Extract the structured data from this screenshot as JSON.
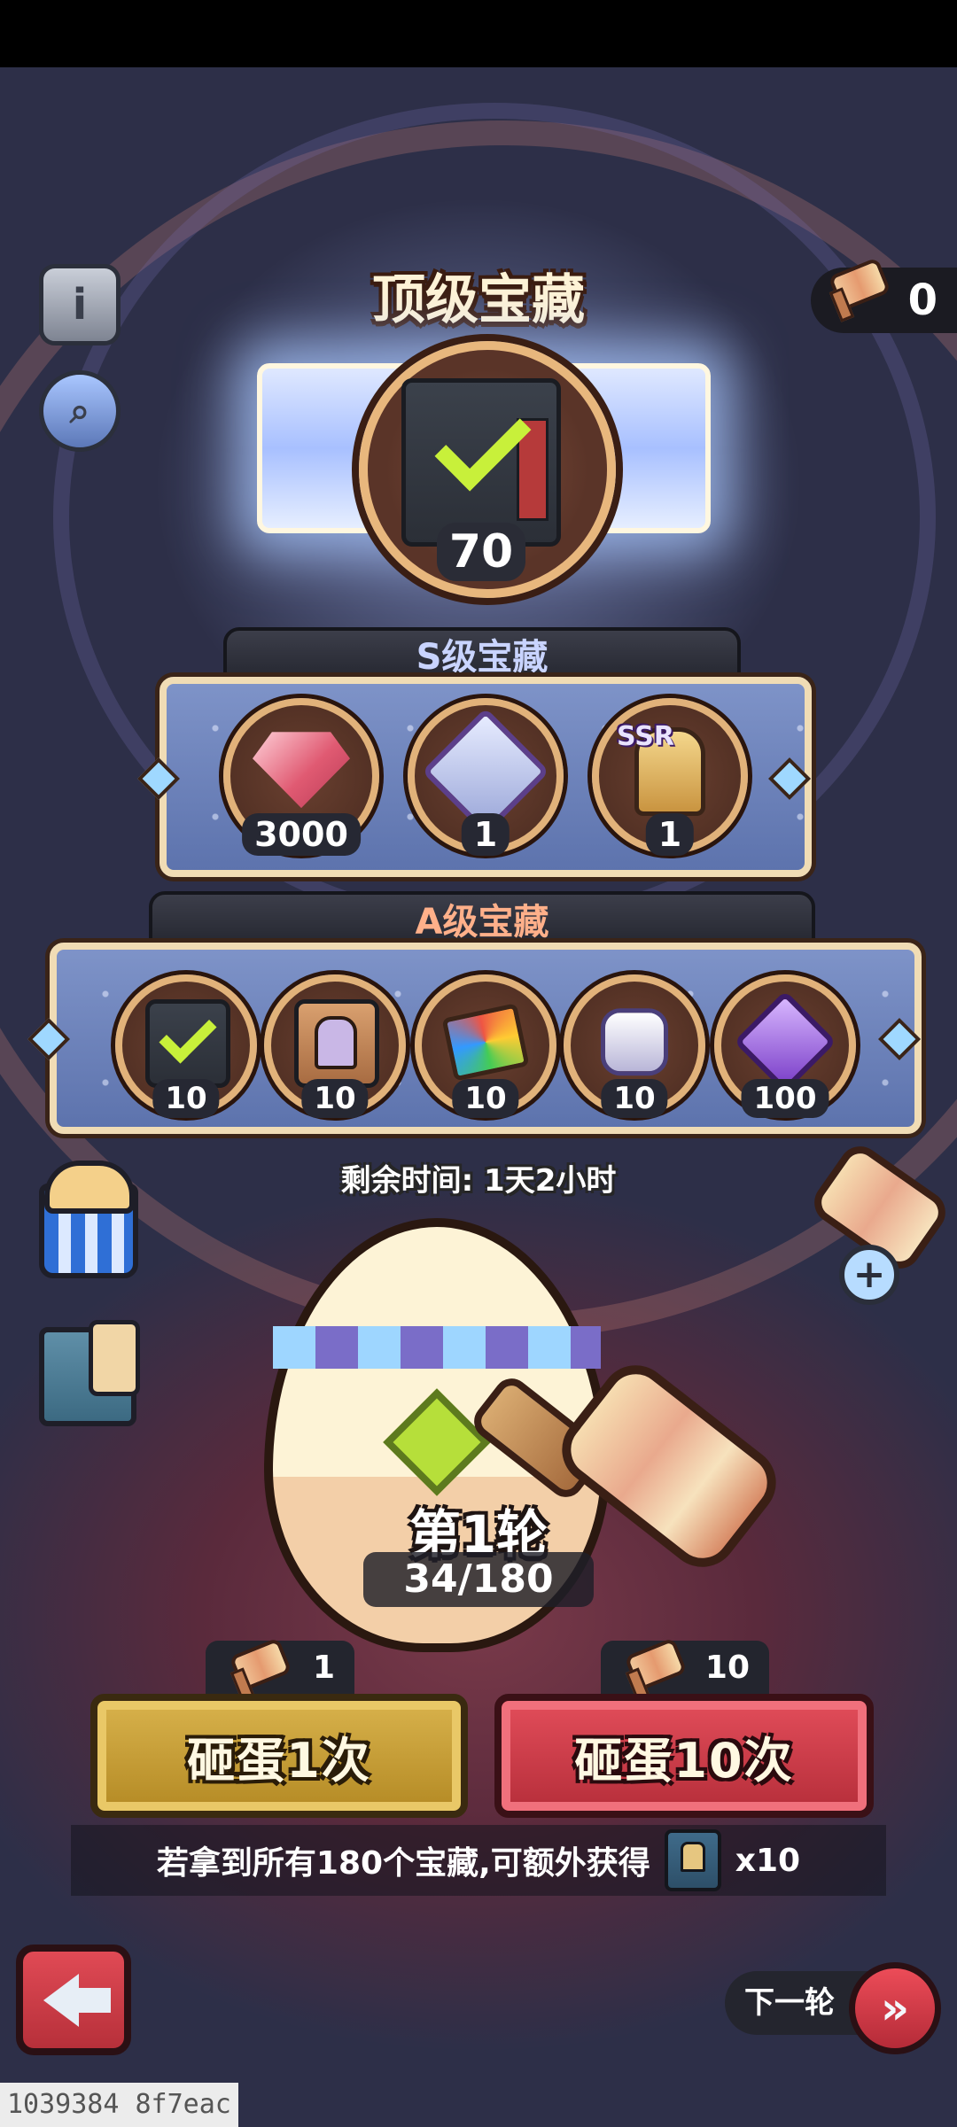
{
  "header": {
    "title": "顶级宝藏",
    "hammer_count": "0"
  },
  "top_prize": {
    "count": "70"
  },
  "s_tier": {
    "label": "S级宝藏",
    "rewards": [
      {
        "icon": "gem-icon",
        "qty": "3000"
      },
      {
        "icon": "emblem-icon",
        "qty": "1"
      },
      {
        "icon": "ssr-hero-card-icon",
        "qty": "1",
        "badge": "SSR"
      }
    ]
  },
  "a_tier": {
    "label": "A级宝藏",
    "rewards": [
      {
        "icon": "book-check-icon",
        "qty": "10"
      },
      {
        "icon": "helmet-book-icon",
        "qty": "10"
      },
      {
        "icon": "card-book-icon",
        "qty": "10"
      },
      {
        "icon": "fist-icon",
        "qty": "10"
      },
      {
        "icon": "purple-emblem-icon",
        "qty": "100"
      }
    ]
  },
  "timer_text": "剩余时间: 1天2小时",
  "round": {
    "label": "第1轮",
    "progress": "34/180"
  },
  "actions": {
    "single": {
      "cost": "1",
      "label": "砸蛋1次"
    },
    "ten": {
      "cost": "10",
      "label": "砸蛋10次"
    }
  },
  "bonus": {
    "text": "若拿到所有180个宝藏,可额外获得",
    "qty": "x10"
  },
  "footer": {
    "next_label": "下一轮",
    "watermark": "1039384 8f7eac"
  },
  "colors": {
    "gold_button": "#c9a136",
    "red_button": "#d23e4b",
    "frame_blue": "#6f86bf"
  }
}
